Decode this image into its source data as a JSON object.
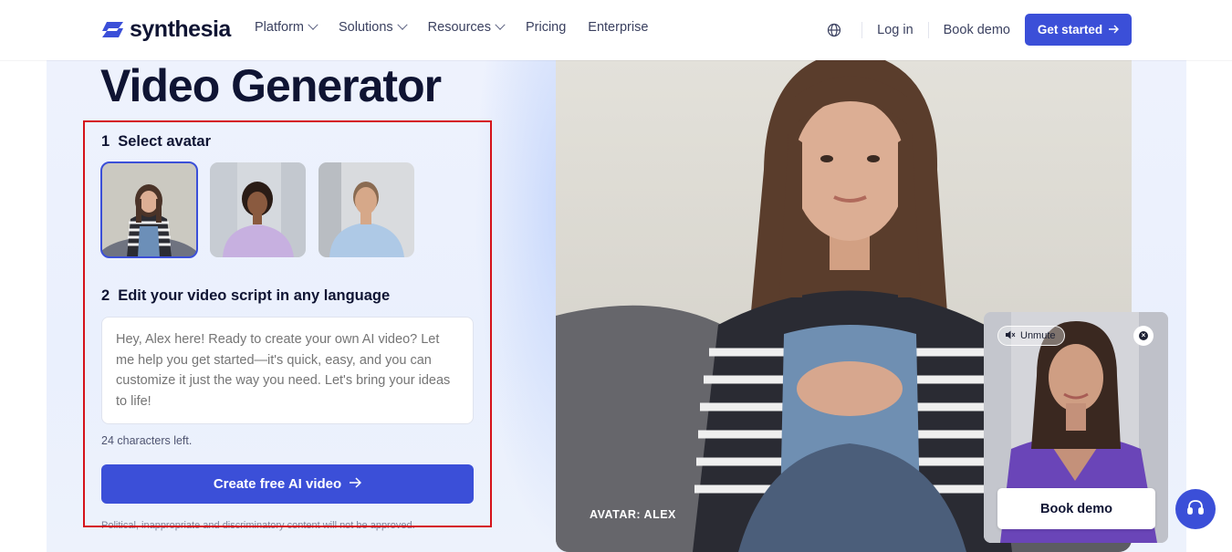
{
  "header": {
    "logo_text": "synthesia",
    "nav": [
      {
        "label": "Platform",
        "has_dropdown": true
      },
      {
        "label": "Solutions",
        "has_dropdown": true
      },
      {
        "label": "Resources",
        "has_dropdown": true
      },
      {
        "label": "Pricing",
        "has_dropdown": false
      },
      {
        "label": "Enterprise",
        "has_dropdown": false
      }
    ],
    "language_icon": "globe-icon",
    "login_label": "Log in",
    "book_demo_label": "Book demo",
    "get_started_label": "Get started"
  },
  "hero": {
    "heading": "Video Generator"
  },
  "form": {
    "step1_number": "1",
    "step1_label": "Select avatar",
    "avatars": [
      {
        "name": "Alex",
        "selected": true
      },
      {
        "name": "",
        "selected": false
      },
      {
        "name": "",
        "selected": false
      }
    ],
    "step2_number": "2",
    "step2_label": "Edit your video script in any language",
    "script_placeholder": "Hey, Alex here! Ready to create your own AI video? Let me help you get started—it's quick, easy, and you can customize it just the way you need. Let's bring your ideas to life!",
    "chars_left": "24 characters left.",
    "create_button_label": "Create free AI video",
    "disclaimer": "Political, inappropriate and discriminatory content will not be approved."
  },
  "video": {
    "avatar_label": "AVATAR: ALEX"
  },
  "widget": {
    "unmute_label": "Unmute",
    "book_demo_label": "Book demo"
  },
  "colors": {
    "brand": "#3b4fd8",
    "highlight_outline": "#d5121a",
    "text_dark": "#0f1433"
  }
}
